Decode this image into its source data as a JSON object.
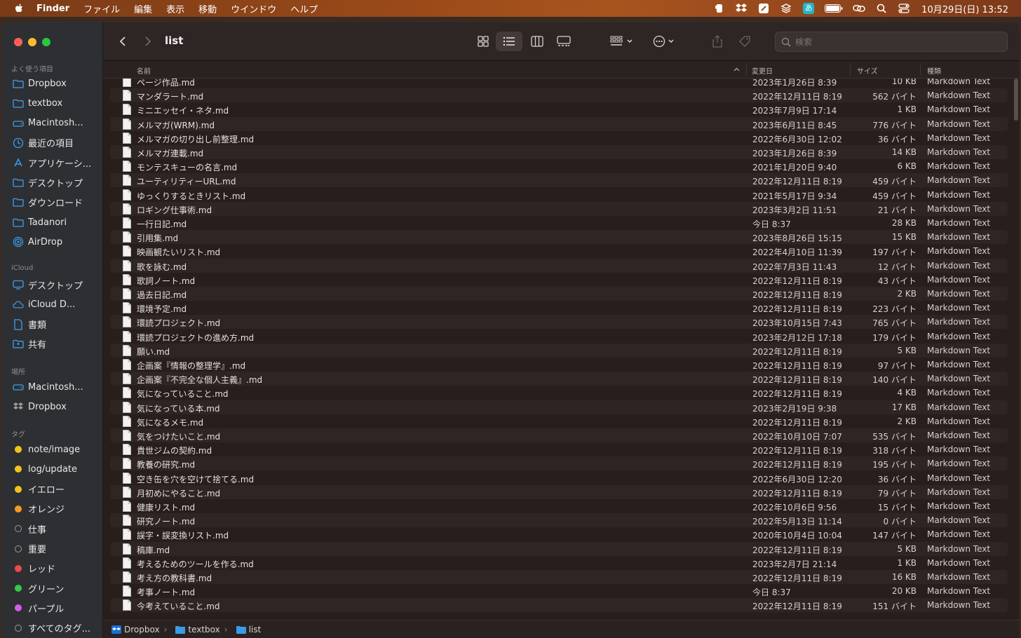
{
  "menubar": {
    "app": "Finder",
    "items": [
      "ファイル",
      "編集",
      "表示",
      "移動",
      "ウインドウ",
      "ヘルプ"
    ],
    "clock": "10月29日(日) 13:52",
    "status_icons": [
      "evernote-icon",
      "dropbox-icon",
      "pen-icon",
      "stack-icon",
      "input-method-icon",
      "battery-icon",
      "link-icon",
      "search-icon",
      "control-center-icon"
    ],
    "input_method": "あ"
  },
  "sidebar": {
    "favorites_label": "よく使う項目",
    "favorites": [
      {
        "label": "Dropbox",
        "icon": "folder-icon"
      },
      {
        "label": "textbox",
        "icon": "folder-icon"
      },
      {
        "label": "Macintosh...",
        "icon": "disk-icon"
      },
      {
        "label": "最近の項目",
        "icon": "clock-icon"
      },
      {
        "label": "アプリケーシ...",
        "icon": "apps-icon"
      },
      {
        "label": "デスクトップ",
        "icon": "folder-icon"
      },
      {
        "label": "ダウンロード",
        "icon": "folder-icon"
      },
      {
        "label": "Tadanori",
        "icon": "folder-icon"
      },
      {
        "label": "AirDrop",
        "icon": "airdrop-icon"
      }
    ],
    "icloud_label": "iCloud",
    "icloud": [
      {
        "label": "デスクトップ",
        "icon": "desktop-icon"
      },
      {
        "label": "iCloud D...",
        "icon": "cloud-icon"
      },
      {
        "label": "書類",
        "icon": "document-icon"
      },
      {
        "label": "共有",
        "icon": "shared-folder-icon"
      }
    ],
    "locations_label": "場所",
    "locations": [
      {
        "label": "Macintosh...",
        "icon": "disk-icon"
      },
      {
        "label": "Dropbox",
        "icon": "dropbox-icon"
      }
    ],
    "tags_label": "タグ",
    "tags": [
      {
        "label": "note/image",
        "color": "#f0c419"
      },
      {
        "label": "log/update",
        "color": "#f0c419"
      },
      {
        "label": "イエロー",
        "color": "#f0c419"
      },
      {
        "label": "オレンジ",
        "color": "#f59b23"
      },
      {
        "label": "仕事",
        "color": ""
      },
      {
        "label": "重要",
        "color": ""
      },
      {
        "label": "レッド",
        "color": "#ee4a46"
      },
      {
        "label": "グリーン",
        "color": "#39c84a"
      },
      {
        "label": "パープル",
        "color": "#d45de8"
      },
      {
        "label": "すべてのタグ...",
        "color": ""
      }
    ]
  },
  "toolbar": {
    "title": "list",
    "search_placeholder": "検索"
  },
  "columns": {
    "name": "名前",
    "date": "変更日",
    "size": "サイズ",
    "kind": "種類"
  },
  "files": [
    {
      "name": "ページ作品.md",
      "date": "2023年1月26日 8:39",
      "size": "10 KB",
      "kind": "Markdown Text"
    },
    {
      "name": "マンダラート.md",
      "date": "2022年12月11日 8:19",
      "size": "562 バイト",
      "kind": "Markdown Text"
    },
    {
      "name": "ミニエッセイ・ネタ.md",
      "date": "2023年7月9日 17:14",
      "size": "1 KB",
      "kind": "Markdown Text"
    },
    {
      "name": "メルマガ(WRM).md",
      "date": "2023年6月11日 8:45",
      "size": "776 バイト",
      "kind": "Markdown Text"
    },
    {
      "name": "メルマガの切り出し前整理.md",
      "date": "2022年6月30日 12:02",
      "size": "36 バイト",
      "kind": "Markdown Text"
    },
    {
      "name": "メルマガ連載.md",
      "date": "2023年1月26日 8:39",
      "size": "14 KB",
      "kind": "Markdown Text"
    },
    {
      "name": "モンテスキューの名言.md",
      "date": "2021年1月20日 9:40",
      "size": "6 KB",
      "kind": "Markdown Text"
    },
    {
      "name": "ユーティリティーURL.md",
      "date": "2022年12月11日 8:19",
      "size": "459 バイト",
      "kind": "Markdown Text"
    },
    {
      "name": "ゆっくりするときリスト.md",
      "date": "2021年5月17日 9:34",
      "size": "459 バイト",
      "kind": "Markdown Text"
    },
    {
      "name": "ロギング仕事術.md",
      "date": "2023年3月2日 11:51",
      "size": "21 バイト",
      "kind": "Markdown Text"
    },
    {
      "name": "一行日記.md",
      "date": "今日 8:37",
      "size": "28 KB",
      "kind": "Markdown Text"
    },
    {
      "name": "引用集.md",
      "date": "2023年8月26日 15:15",
      "size": "15 KB",
      "kind": "Markdown Text"
    },
    {
      "name": "映画観たいリスト.md",
      "date": "2022年4月10日 11:39",
      "size": "197 バイト",
      "kind": "Markdown Text"
    },
    {
      "name": "歌を詠む.md",
      "date": "2022年7月3日 11:43",
      "size": "12 バイト",
      "kind": "Markdown Text"
    },
    {
      "name": "歌詞ノート.md",
      "date": "2022年12月11日 8:19",
      "size": "43 バイト",
      "kind": "Markdown Text"
    },
    {
      "name": "過去日記.md",
      "date": "2022年12月11日 8:19",
      "size": "2 KB",
      "kind": "Markdown Text"
    },
    {
      "name": "環境予定.md",
      "date": "2022年12月11日 8:19",
      "size": "223 バイト",
      "kind": "Markdown Text"
    },
    {
      "name": "環読プロジェクト.md",
      "date": "2023年10月15日 7:43",
      "size": "765 バイト",
      "kind": "Markdown Text"
    },
    {
      "name": "環読プロジェクトの進め方.md",
      "date": "2023年2月12日 17:18",
      "size": "179 バイト",
      "kind": "Markdown Text"
    },
    {
      "name": "願い.md",
      "date": "2022年12月11日 8:19",
      "size": "5 KB",
      "kind": "Markdown Text"
    },
    {
      "name": "企画案『情報の整理学』.md",
      "date": "2022年12月11日 8:19",
      "size": "97 バイト",
      "kind": "Markdown Text"
    },
    {
      "name": "企画案『不完全な個人主義』.md",
      "date": "2022年12月11日 8:19",
      "size": "140 バイト",
      "kind": "Markdown Text"
    },
    {
      "name": "気になっていること.md",
      "date": "2022年12月11日 8:19",
      "size": "4 KB",
      "kind": "Markdown Text"
    },
    {
      "name": "気になっている本.md",
      "date": "2023年2月19日 9:38",
      "size": "17 KB",
      "kind": "Markdown Text"
    },
    {
      "name": "気になるメモ.md",
      "date": "2022年12月11日 8:19",
      "size": "2 KB",
      "kind": "Markdown Text"
    },
    {
      "name": "気をつけたいこと.md",
      "date": "2022年10月10日 7:07",
      "size": "535 バイト",
      "kind": "Markdown Text"
    },
    {
      "name": "貴世ジムの契約.md",
      "date": "2022年12月11日 8:19",
      "size": "318 バイト",
      "kind": "Markdown Text"
    },
    {
      "name": "教養の研究.md",
      "date": "2022年12月11日 8:19",
      "size": "195 バイト",
      "kind": "Markdown Text"
    },
    {
      "name": "空き缶を穴を空けて捨てる.md",
      "date": "2022年6月30日 12:20",
      "size": "36 バイト",
      "kind": "Markdown Text"
    },
    {
      "name": "月初めにやること.md",
      "date": "2022年12月11日 8:19",
      "size": "79 バイト",
      "kind": "Markdown Text"
    },
    {
      "name": "健康リスト.md",
      "date": "2022年10月6日 9:56",
      "size": "15 バイト",
      "kind": "Markdown Text"
    },
    {
      "name": "研究ノート.md",
      "date": "2022年5月13日 11:14",
      "size": "0 バイト",
      "kind": "Markdown Text"
    },
    {
      "name": "誤字・誤変換リスト.md",
      "date": "2020年10月4日 10:04",
      "size": "147 バイト",
      "kind": "Markdown Text"
    },
    {
      "name": "稿庫.md",
      "date": "2022年12月11日 8:19",
      "size": "5 KB",
      "kind": "Markdown Text"
    },
    {
      "name": "考えるためのツールを作る.md",
      "date": "2023年2月7日 21:14",
      "size": "1 KB",
      "kind": "Markdown Text"
    },
    {
      "name": "考え方の教科書.md",
      "date": "2022年12月11日 8:19",
      "size": "16 KB",
      "kind": "Markdown Text"
    },
    {
      "name": "考事ノート.md",
      "date": "今日 8:37",
      "size": "20 KB",
      "kind": "Markdown Text"
    },
    {
      "name": "今考えていること.md",
      "date": "2022年12月11日 8:19",
      "size": "151 バイト",
      "kind": "Markdown Text"
    }
  ],
  "pathbar": [
    "Dropbox",
    "textbox",
    "list"
  ]
}
